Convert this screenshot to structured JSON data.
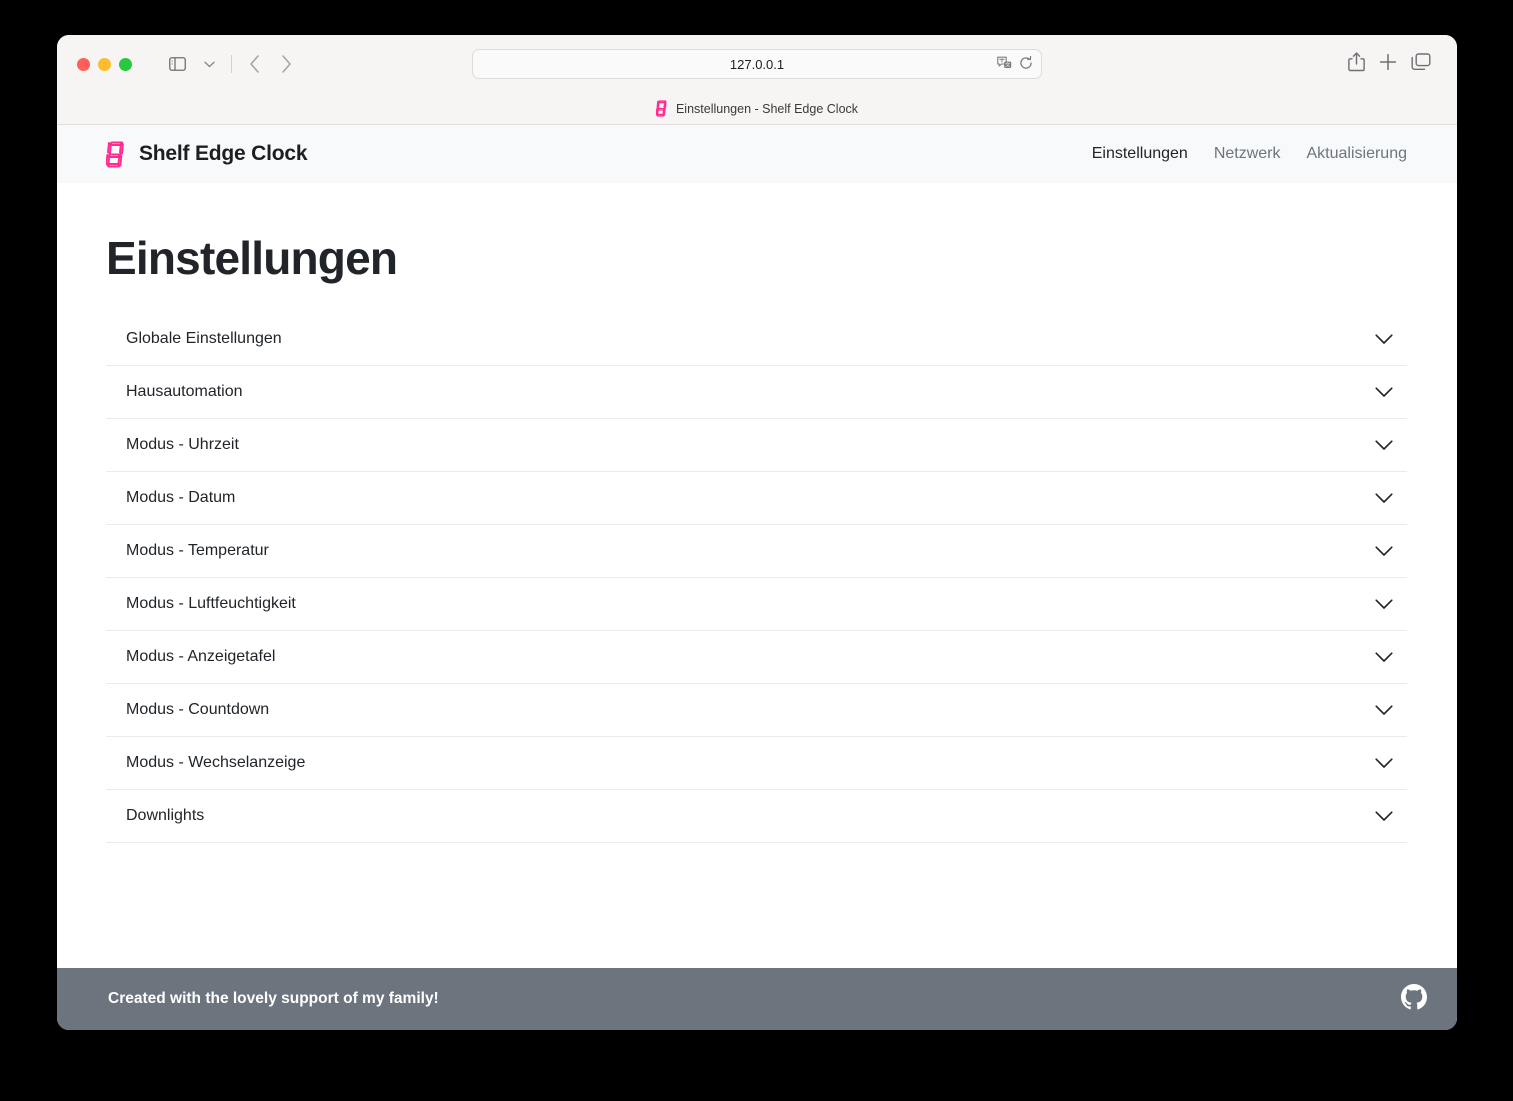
{
  "browser": {
    "url": "127.0.0.1",
    "tab_title": "Einstellungen - Shelf Edge Clock",
    "traffic_lights": [
      "close",
      "minimize",
      "zoom"
    ],
    "icons": {
      "sidebar": "sidebar-icon",
      "sidebar_dropdown": "chevron-down-icon",
      "back": "back-arrow-icon",
      "forward": "forward-arrow-icon",
      "password": "password-manager-icon",
      "translate": "translate-icon",
      "reload": "reload-icon",
      "share": "share-icon",
      "new_tab": "plus-icon",
      "tab_overview": "tab-overview-icon"
    }
  },
  "navbar": {
    "brand": "Shelf Edge Clock",
    "brand_logo": "seven-segment-eight-icon",
    "links": [
      {
        "label": "Einstellungen",
        "active": true
      },
      {
        "label": "Netzwerk",
        "active": false
      },
      {
        "label": "Aktualisierung",
        "active": false
      }
    ]
  },
  "main": {
    "title": "Einstellungen",
    "accordion": [
      {
        "label": "Globale Einstellungen"
      },
      {
        "label": "Hausautomation"
      },
      {
        "label": "Modus - Uhrzeit"
      },
      {
        "label": "Modus - Datum"
      },
      {
        "label": "Modus - Temperatur"
      },
      {
        "label": "Modus - Luftfeuchtigkeit"
      },
      {
        "label": "Modus - Anzeigetafel"
      },
      {
        "label": "Modus - Countdown"
      },
      {
        "label": "Modus - Wechselanzeige"
      },
      {
        "label": "Downlights"
      }
    ]
  },
  "footer": {
    "text": "Created with the lovely support of my family!",
    "github_icon": "github-icon"
  },
  "colors": {
    "brand_pink": "#ff2d92",
    "footer_bg": "#6c757d",
    "navbar_bg": "#f8f9fa",
    "text_dark": "#212529",
    "text_muted": "#6c757d",
    "divider": "#e9ecef"
  }
}
